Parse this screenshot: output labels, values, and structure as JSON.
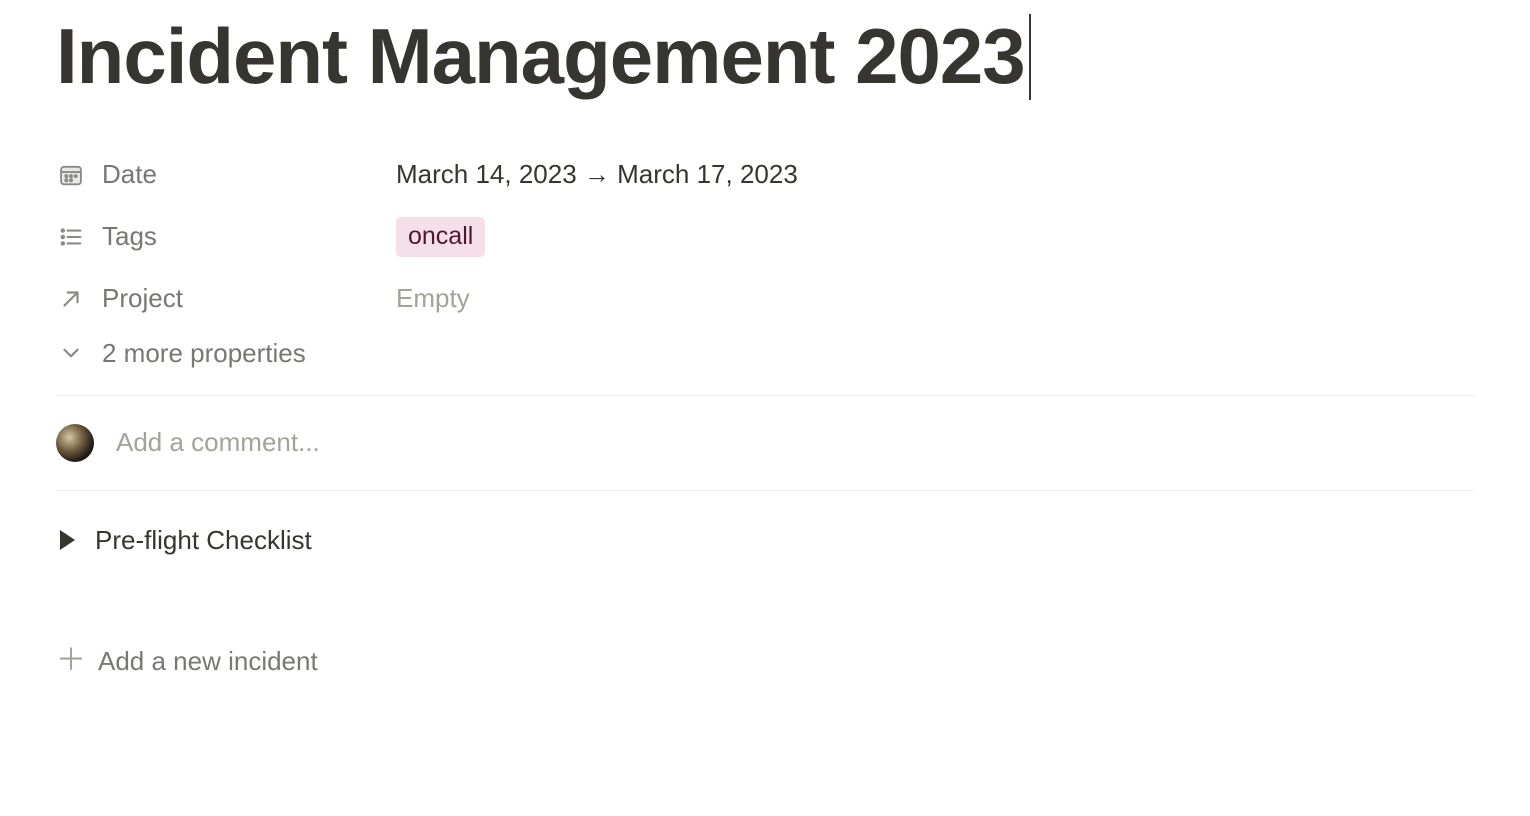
{
  "title": "Incident Management 2023",
  "properties": {
    "date": {
      "label": "Date",
      "value": "March 14, 2023 → March 17, 2023"
    },
    "tags": {
      "label": "Tags",
      "value": "oncall"
    },
    "project": {
      "label": "Project",
      "value": "Empty"
    }
  },
  "more_properties_label": "2 more properties",
  "comment": {
    "placeholder": "Add a comment..."
  },
  "toggle": {
    "label": "Pre-flight Checklist"
  },
  "add_incident": {
    "label": "Add a new incident"
  }
}
